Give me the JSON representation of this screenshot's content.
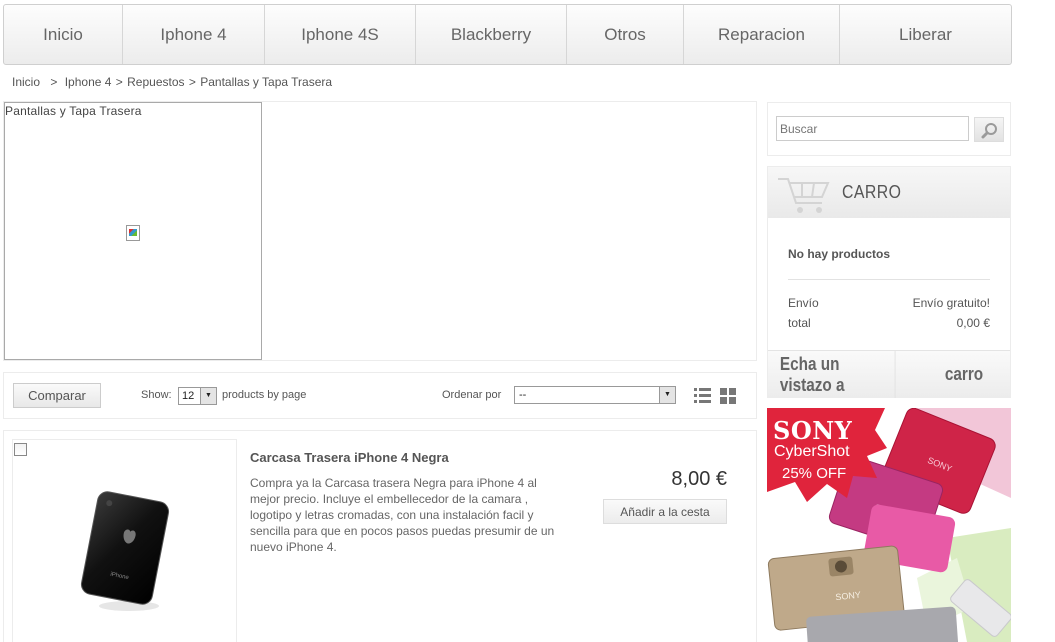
{
  "nav": {
    "items": [
      {
        "label": "Inicio"
      },
      {
        "label": "Iphone 4"
      },
      {
        "label": "Iphone 4S"
      },
      {
        "label": "Blackberry"
      },
      {
        "label": "Otros"
      },
      {
        "label": "Reparacion"
      },
      {
        "label": "Liberar"
      }
    ]
  },
  "breadcrumb": {
    "home": "Inicio",
    "sep": ">",
    "items": [
      "Iphone 4",
      "Repuestos",
      "Pantallas y Tapa Trasera"
    ]
  },
  "category": {
    "image_alt": "Pantallas y Tapa Trasera"
  },
  "toolbar": {
    "compare_label": "Comparar",
    "show_label": "Show:",
    "per_page_value": "12",
    "per_page_suffix": "products by page",
    "order_label": "Ordenar por",
    "order_value": "--"
  },
  "product": {
    "title": "Carcasa Trasera iPhone 4 Negra",
    "description": "Compra ya la Carcasa trasera Negra para iPhone 4 al mejor precio. Incluye el embellecedor de la camara , logotipo y letras cromadas, con una instalación facil y sencilla para que en pocos pasos puedas presumir de un nuevo iPhone 4.",
    "price": "8,00 €",
    "add_label": "Añadir a la cesta",
    "image_brand_text": "iPhone"
  },
  "search": {
    "placeholder": "Buscar"
  },
  "cart": {
    "title": "CARRO",
    "empty_text": "No hay productos",
    "shipping_label": "Envío",
    "shipping_value": "Envío gratuito!",
    "total_label": "total",
    "total_value": "0,00 €",
    "footer_left": "Echa un vistazo a",
    "footer_right": "carro"
  },
  "ad": {
    "brand": "SONY",
    "line2": "CyberShot",
    "line3": "25% OFF",
    "camera_label": "SONY"
  },
  "colors": {
    "ad_red": "#e0243c",
    "ad_pink": "#c43a82",
    "ad_magenta": "#e85aa6"
  }
}
